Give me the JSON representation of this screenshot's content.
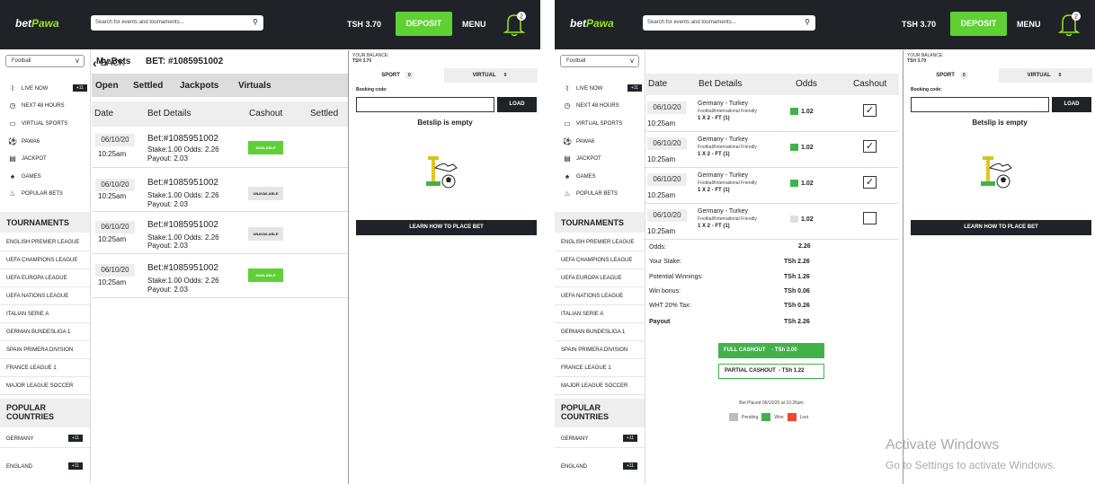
{
  "header": {
    "logo_a": "bet",
    "logo_b": "Pawa",
    "search_placeholder": "Search for events and tournaments...",
    "balance": "TSH 3.70",
    "deposit": "DEPOSIT",
    "menu": "MENU",
    "notifications": "2"
  },
  "sidebar": {
    "sport_select": "Football",
    "items": [
      {
        "label": "LIVE NOW",
        "badge": "+11",
        "icon": "pulse-icon"
      },
      {
        "label": "NEXT 48 HOURS",
        "icon": "clock-icon"
      },
      {
        "label": "VIRTUAL SPORTS",
        "icon": "monitor-icon"
      },
      {
        "label": "PAWA6",
        "icon": "ball-icon"
      },
      {
        "label": "JACKPOT",
        "icon": "ticket-icon"
      },
      {
        "label": "GAMES",
        "icon": "spade-icon"
      },
      {
        "label": "POPULAR BETS",
        "icon": "flame-icon"
      }
    ],
    "tournaments_title": "TOURNAMENTS",
    "tournaments": [
      "ENGLISH PREMIER LEAGUE",
      "UEFA CHAMPIONS LEAGUE",
      "UEFA EUROPA LEAGUE",
      "UEFA NATIONS LEAGUE",
      "ITALIAN SERIE A",
      "GERMAN BUNDESLIGA 1",
      "SPAIN PRIMERA DIVISION",
      "FRANCE LEAGUE 1",
      "MAJOR LEAGUE SOCCER"
    ],
    "countries_title_1": "POPULAR",
    "countries_title_2": "COUNTRIES",
    "countries": [
      {
        "label": "GERMANY",
        "badge": "+11"
      },
      {
        "label": "ENGLAND",
        "badge": "+11"
      }
    ]
  },
  "mybets": {
    "title": "My Bets",
    "tabs": [
      "Open",
      "Settled",
      "Jackpots",
      "Virtuals"
    ],
    "columns": [
      "Date",
      "Bet Details",
      "Cashout",
      "Settled"
    ],
    "rows": [
      {
        "date": "06/10/20",
        "time": "10:25am",
        "bet": "Bet:#1085951002",
        "stake": "Stake:1.00 Odds: 2.26",
        "payout": "Payout: 2.03",
        "status": "AVAILABLE"
      },
      {
        "date": "06/10/20",
        "time": "10:25am",
        "bet": "Bet:#1085951002",
        "stake": "Stake:1.00 Odds: 2.26",
        "payout": "Payout: 2.03",
        "status": "UNAVAILABLE"
      },
      {
        "date": "06/10/20",
        "time": "10:25am",
        "bet": "Bet:#1085951002",
        "stake": "Stake:1.00 Odds: 2.26",
        "payout": "Payout: 2.03",
        "status": "UNAVAILABLE"
      },
      {
        "date": "06/10/20",
        "time": "10:25am",
        "bet": "Bet:#1085951002",
        "stake": "Stake:1.00 Odds: 2.26",
        "payout": "Payout: 2.03",
        "status": "AVAILABLE"
      }
    ]
  },
  "betslip": {
    "your_balance": "YOUR BALANCE:",
    "balance": "TSH 3.70",
    "tab_sport": "SPORT",
    "tab_sport_count": "0",
    "tab_virtual": "VIRTUAL",
    "tab_virtual_count": "0",
    "booking_label": "Booking code:",
    "load": "LOAD",
    "empty": "Betslip is empty",
    "learn": "LEARN HOW TO PLACE BET"
  },
  "detail": {
    "back": "BACK",
    "bet_no": "BET: #1085951002",
    "columns": [
      "Date",
      "Bet Details",
      "Odds",
      "Cashout"
    ],
    "rows": [
      {
        "date": "06/10/20",
        "time": "10:25am",
        "match": "Germany - Turkey",
        "sub": "Football/International Friendly",
        "market": "1 X 2 - FT (1)",
        "odds": "1.02",
        "state": "won",
        "checked": "✓"
      },
      {
        "date": "06/10/20",
        "time": "10:25am",
        "match": "Germany - Turkey",
        "sub": "Football/International Friendly",
        "market": "1 X 2 - FT (1)",
        "odds": "1.02",
        "state": "won",
        "checked": "✓"
      },
      {
        "date": "06/10/20",
        "time": "10:25am",
        "match": "Germany - Turkey",
        "sub": "Football/International Friendly",
        "market": "1 X 2 - FT (1)",
        "odds": "1.02",
        "state": "won",
        "checked": "✓"
      },
      {
        "date": "06/10/20",
        "time": "10:25am",
        "match": "Germany - Turkey",
        "sub": "Football/International Friendly",
        "market": "1 X 2 - FT (1)",
        "odds": "1.02",
        "state": "pending",
        "checked": ""
      }
    ],
    "summary": [
      {
        "label": "Odds:",
        "value": "2.26"
      },
      {
        "label": "Your Stake:",
        "value": "TSh 2.26"
      },
      {
        "label": "Potential Winnings:",
        "value": "TSh 1.26"
      },
      {
        "label": "Win bonus:",
        "value": "TSh 0.06"
      },
      {
        "label": "WHT 20% Tax:",
        "value": "TSh 0.26"
      },
      {
        "label": "Payout",
        "value": "TSh 2.26"
      }
    ],
    "full_cashout": "FULL CASHOUT",
    "full_cashout_value": "- TSh 2.00",
    "partial_cashout": "PARTIAL CASHOUT",
    "partial_cashout_value": "- TSh 1.22",
    "placed": "Bet Placed 06/10/20 at 10:26am",
    "legend": [
      "Pending",
      "Won",
      "Lost"
    ]
  },
  "colors": {
    "won": "#3fb34a",
    "pending": "#e0e0e0",
    "lost": "#e84a2a",
    "accent": "#5fd134"
  },
  "watermark": {
    "line1": "Activate Windows",
    "line2": "Go to Settings to activate Windows."
  }
}
